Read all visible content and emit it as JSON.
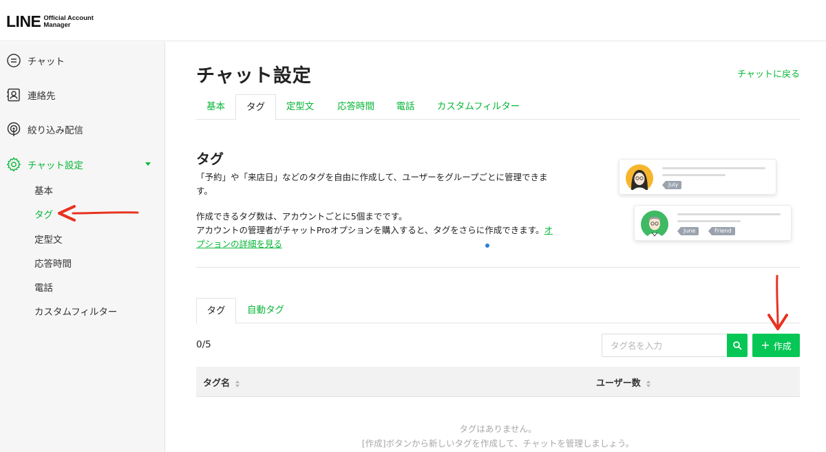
{
  "header": {
    "logo_main": "LINE",
    "logo_sub_line1": "Official Account",
    "logo_sub_line2": "Manager"
  },
  "sidebar": {
    "items": [
      {
        "label": "チャット",
        "icon": "chat-bubble-icon"
      },
      {
        "label": "連絡先",
        "icon": "contact-card-icon"
      },
      {
        "label": "絞り込み配信",
        "icon": "broadcast-icon"
      },
      {
        "label": "チャット設定",
        "icon": "gear-icon",
        "active": true
      }
    ],
    "sub_items": [
      {
        "label": "基本"
      },
      {
        "label": "タグ",
        "active": true
      },
      {
        "label": "定型文"
      },
      {
        "label": "応答時間"
      },
      {
        "label": "電話"
      },
      {
        "label": "カスタムフィルター"
      }
    ]
  },
  "main": {
    "title": "チャット設定",
    "back_link": "チャットに戻る",
    "tabs": [
      {
        "label": "基本"
      },
      {
        "label": "タグ",
        "active": true
      },
      {
        "label": "定型文"
      },
      {
        "label": "応答時間"
      },
      {
        "label": "電話"
      },
      {
        "label": "カスタムフィルター"
      }
    ],
    "section_title": "タグ",
    "desc_line1": "「予約」や「来店日」などのタグを自由に作成して、ユーザーをグループごとに管理できま",
    "desc_line2": "す。",
    "desc_line3": "作成できるタグ数は、アカウントごとに5個までです。",
    "desc_line4": "アカウントの管理者がチャットProオプションを購入すると、タグをさらに作成できます。",
    "desc_link_part1": "オ",
    "desc_link_part2": "プションの詳細を見る",
    "illustration": {
      "card1_tag": "July",
      "card2_tags": [
        "June",
        "Friend"
      ]
    },
    "tag_tabs": [
      {
        "label": "タグ",
        "active": true
      },
      {
        "label": "自動タグ"
      }
    ],
    "count": "0/5",
    "search": {
      "placeholder": "タグ名を入力",
      "value": ""
    },
    "create_label": "作成",
    "table": {
      "headers": [
        "タグ名",
        "ユーザー数"
      ],
      "empty_line1": "タグはありません。",
      "empty_line2": "[作成]ボタンから新しいタグを作成して、チャットを管理しましょう。"
    }
  },
  "colors": {
    "accent": "#06c755",
    "link_green": "#06b636",
    "annotation_arrow": "#e8321e"
  }
}
